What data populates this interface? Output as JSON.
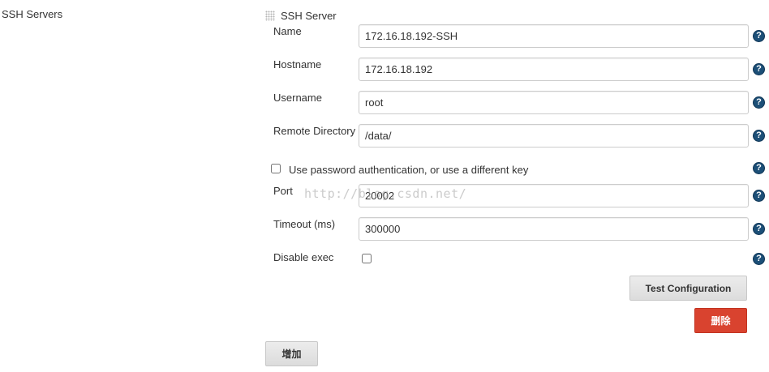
{
  "section": {
    "label": "SSH Servers"
  },
  "server": {
    "title": "SSH Server",
    "name": {
      "label": "Name",
      "value": "172.16.18.192-SSH"
    },
    "hostname": {
      "label": "Hostname",
      "value": "172.16.18.192"
    },
    "username": {
      "label": "Username",
      "value": "root"
    },
    "remote_directory": {
      "label": "Remote Directory",
      "value": "/data/"
    },
    "use_password": {
      "label": "Use password authentication, or use a different key",
      "checked": false
    },
    "port": {
      "label": "Port",
      "value": "20002"
    },
    "timeout": {
      "label": "Timeout (ms)",
      "value": "300000"
    },
    "disable_exec": {
      "label": "Disable exec",
      "checked": false
    }
  },
  "buttons": {
    "test_configuration": "Test Configuration",
    "delete": "删除",
    "add": "增加"
  },
  "help_icon_glyph": "?",
  "watermark": "http://blog.csdn.net/",
  "colors": {
    "help_icon": "#1c4f77",
    "delete_button": "#d9432f",
    "button_gray": "#e4e4e4",
    "input_border": "#cccccc"
  }
}
